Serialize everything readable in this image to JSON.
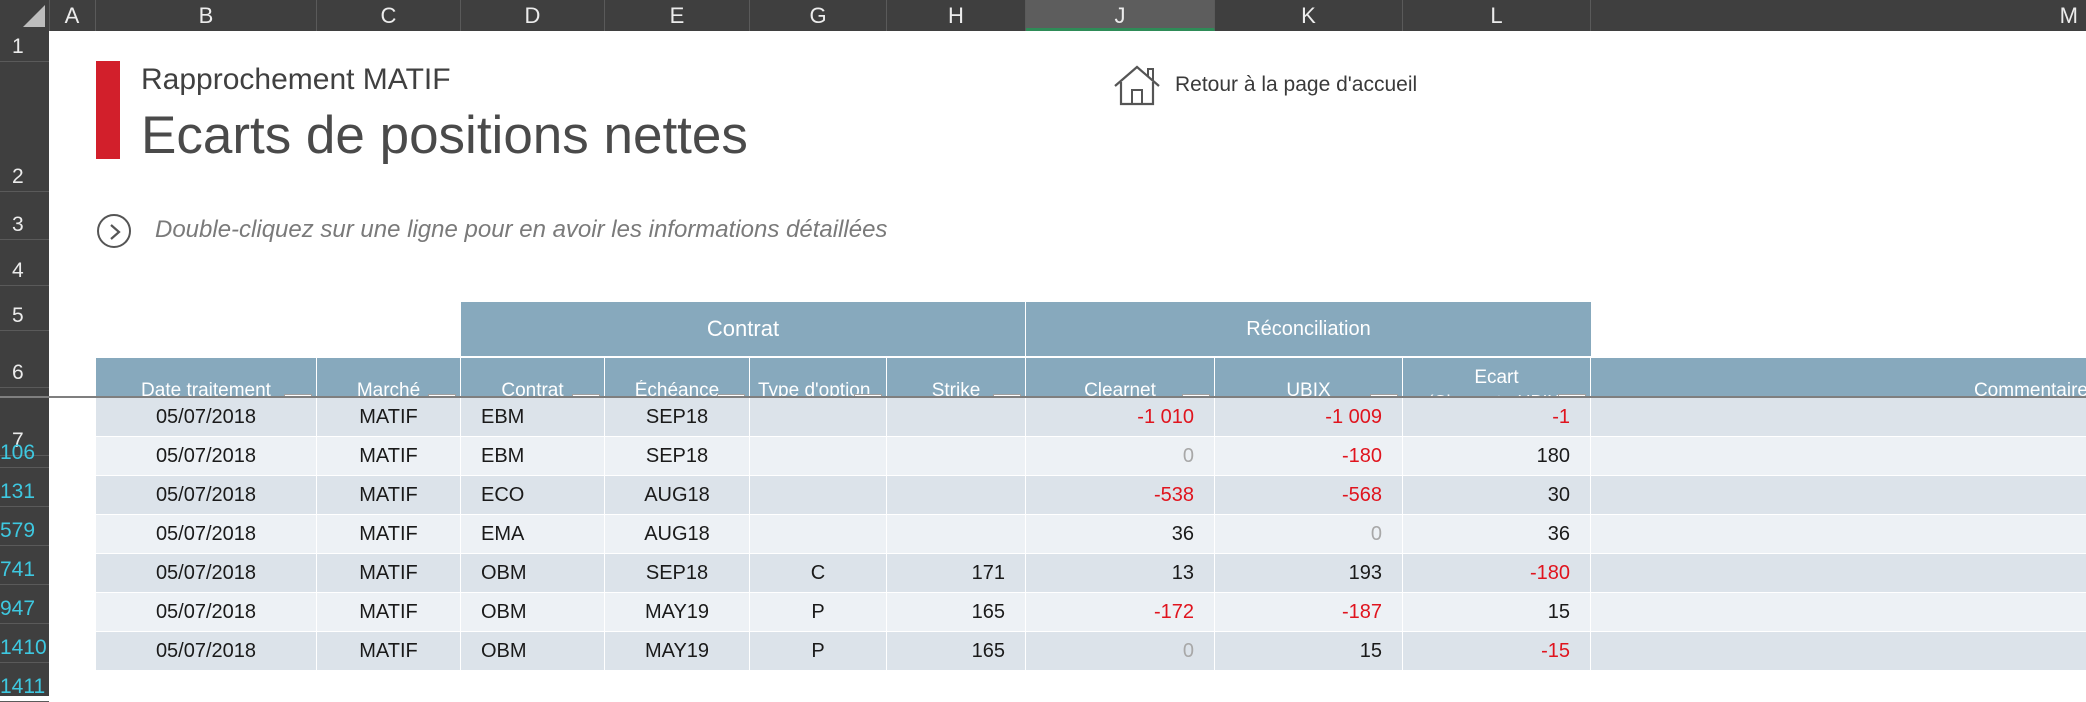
{
  "sheet": {
    "columns": [
      "A",
      "B",
      "C",
      "D",
      "E",
      "G",
      "H",
      "J",
      "K",
      "L",
      "M"
    ],
    "selected_column": "J",
    "rows": [
      "1",
      "2",
      "3",
      "4",
      "5",
      "6",
      "7"
    ],
    "data_rows": [
      "106",
      "131",
      "579",
      "741",
      "947",
      "1410",
      "1411"
    ]
  },
  "header": {
    "subtitle": "Rapprochement MATIF",
    "title": "Ecarts de positions nettes",
    "home_label": "Retour à la page d'accueil",
    "hint": "Double-cliquez sur une ligne pour en avoir les informations détaillées"
  },
  "table": {
    "group_contrat": "Contrat",
    "group_reconciliation": "Réconciliation",
    "col_date": "Date traitement",
    "col_marche": "Marché",
    "col_contrat": "Contrat",
    "col_echeance": "Échéance",
    "col_type": "Type d'option",
    "col_strike": "Strike",
    "col_clearnet": "Clearnet",
    "col_ubix": "UBIX",
    "col_ecart_line1": "Ecart",
    "col_ecart_line2": "(Clearnet - UBIX)",
    "col_commentaire": "Commentaire",
    "rows": [
      {
        "row": "106",
        "date": "05/07/2018",
        "marche": "MATIF",
        "contrat": "EBM",
        "echeance": "SEP18",
        "type": "",
        "strike": "",
        "clearnet": "-1 010",
        "ubix": "-1 009",
        "ecart": "-1"
      },
      {
        "row": "131",
        "date": "05/07/2018",
        "marche": "MATIF",
        "contrat": "EBM",
        "echeance": "SEP18",
        "type": "",
        "strike": "",
        "clearnet": "0",
        "ubix": "-180",
        "ecart": "180"
      },
      {
        "row": "579",
        "date": "05/07/2018",
        "marche": "MATIF",
        "contrat": "ECO",
        "echeance": "AUG18",
        "type": "",
        "strike": "",
        "clearnet": "-538",
        "ubix": "-568",
        "ecart": "30"
      },
      {
        "row": "741",
        "date": "05/07/2018",
        "marche": "MATIF",
        "contrat": "EMA",
        "echeance": "AUG18",
        "type": "",
        "strike": "",
        "clearnet": "36",
        "ubix": "0",
        "ecart": "36"
      },
      {
        "row": "947",
        "date": "05/07/2018",
        "marche": "MATIF",
        "contrat": "OBM",
        "echeance": "SEP18",
        "type": "C",
        "strike": "171",
        "clearnet": "13",
        "ubix": "193",
        "ecart": "-180"
      },
      {
        "row": "1410",
        "date": "05/07/2018",
        "marche": "MATIF",
        "contrat": "OBM",
        "echeance": "MAY19",
        "type": "P",
        "strike": "165",
        "clearnet": "-172",
        "ubix": "-187",
        "ecart": "15"
      },
      {
        "row": "1411",
        "date": "05/07/2018",
        "marche": "MATIF",
        "contrat": "OBM",
        "echeance": "MAY19",
        "type": "P",
        "strike": "165",
        "clearnet": "0",
        "ubix": "15",
        "ecart": "-15"
      }
    ]
  },
  "colors": {
    "accent_red": "#d21f2b",
    "header_blue": "#87a9bd",
    "row_dark": "#dce3ea",
    "row_light": "#edf1f5",
    "negative": "#e0141e",
    "zero": "#a8a8a8"
  },
  "icons": {
    "home": "house-icon",
    "hint": "circle-chevron-right-icon",
    "filter": "dropdown-arrow-icon",
    "filter_active": "funnel-icon"
  }
}
